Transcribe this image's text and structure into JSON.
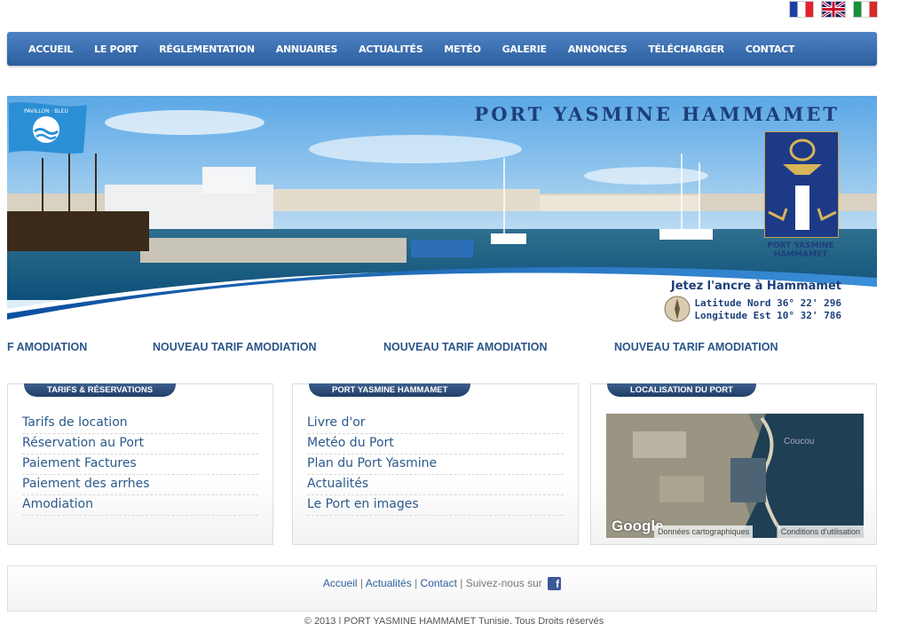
{
  "languages": [
    {
      "code": "fr",
      "icon": "flag-fr-icon"
    },
    {
      "code": "en",
      "icon": "flag-uk-icon"
    },
    {
      "code": "it",
      "icon": "flag-it-icon"
    }
  ],
  "nav": {
    "items": [
      "ACCUEIL",
      "LE PORT",
      "RÉGLEMENTATION",
      "ANNUAIRES",
      "ACTUALITÉS",
      "METÉO",
      "GALERIE",
      "ANNONCES",
      "TÉLÉCHARGER",
      "CONTACT"
    ]
  },
  "banner": {
    "title": "PORT YASMINE HAMMAMET",
    "logo_caption_1": "PORT YASMINE",
    "logo_caption_2": "HAMMAMET",
    "pavillon_text": "PAVILLON · BLEU",
    "tagline": "Jetez l'ancre à Hammamet",
    "latitude": "Latitude Nord 36° 22' 296",
    "longitude": "Longitude Est 10° 32' 786"
  },
  "ticker": {
    "first_fragment": "F AMODIATION",
    "items": [
      "NOUVEAU TARIF AMODIATION",
      "NOUVEAU TARIF AMODIATION",
      "NOUVEAU TARIF AMODIATION"
    ]
  },
  "boxes": {
    "tarifs": {
      "title": "TARIFS & RÉSERVATIONS",
      "links": [
        "Tarifs de location",
        "Réservation au Port",
        "Paiement Factures",
        "Paiement des arrhes",
        "Amodiation"
      ]
    },
    "port": {
      "title": "PORT YASMINE HAMMAMET",
      "links": [
        "Livre d'or",
        "Metéo du Port",
        "Plan du Port Yasmine",
        "Actualités",
        "Le Port en images"
      ]
    },
    "location": {
      "title": "LOCALISATION DU PORT",
      "map_brand": "Google",
      "map_data": "Données cartographiques",
      "map_terms": "Conditions d'utilisation",
      "map_label": "Coucou"
    }
  },
  "footer": {
    "links": [
      "Accueil",
      "Actualités",
      "Contact"
    ],
    "follow_text": "Suivez-nous sur",
    "facebook_icon": "facebook-icon",
    "copyright": "© 2013 | PORT YASMINE HAMMAMET Tunisie. Tous Droits réservés"
  },
  "colors": {
    "nav_blue": "#2d5f9e",
    "link_blue": "#2b5a8a",
    "tab_dark": "#1f3e68",
    "brand_navy": "#1d3f7a"
  }
}
